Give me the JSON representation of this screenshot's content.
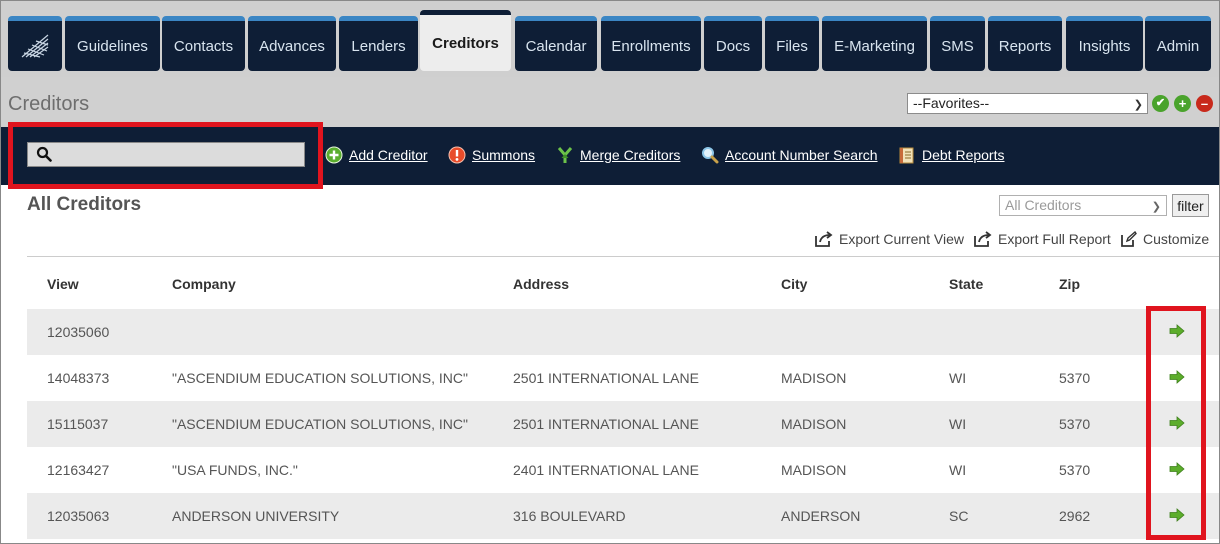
{
  "nav": {
    "tabs": [
      {
        "label": "Guidelines",
        "active": false
      },
      {
        "label": "Contacts",
        "active": false
      },
      {
        "label": "Advances",
        "active": false
      },
      {
        "label": "Lenders",
        "active": false
      },
      {
        "label": "Creditors",
        "active": true
      },
      {
        "label": "Calendar",
        "active": false
      },
      {
        "label": "Enrollments",
        "active": false
      },
      {
        "label": "Docs",
        "active": false
      },
      {
        "label": "Files",
        "active": false
      },
      {
        "label": "E-Marketing",
        "active": false
      },
      {
        "label": "SMS",
        "active": false
      },
      {
        "label": "Reports",
        "active": false
      },
      {
        "label": "Insights",
        "active": false
      },
      {
        "label": "Admin",
        "active": false
      }
    ]
  },
  "header": {
    "title": "Creditors",
    "favorites_value": "--Favorites--"
  },
  "toolbar": {
    "search_value": "",
    "links": {
      "add_creditor": "Add Creditor",
      "summons": "Summons",
      "merge_creditors": "Merge Creditors",
      "account_number_search": "Account Number Search",
      "debt_reports": "Debt Reports"
    }
  },
  "main": {
    "section_title": "All Creditors",
    "filter_value": "All Creditors",
    "filter_button": "filter",
    "actions": {
      "export_current": "Export Current View",
      "export_full": "Export Full Report",
      "customize": "Customize"
    },
    "table": {
      "columns": {
        "view": "View",
        "company": "Company",
        "address": "Address",
        "city": "City",
        "state": "State",
        "zip": "Zip"
      },
      "rows": [
        {
          "view": "12035060",
          "company": "",
          "address": "",
          "city": "",
          "state": "",
          "zip": ""
        },
        {
          "view": "14048373",
          "company": "\"ASCENDIUM EDUCATION SOLUTIONS, INC\"",
          "address": "2501 INTERNATIONAL LANE",
          "city": "MADISON",
          "state": "WI",
          "zip": "5370"
        },
        {
          "view": "15115037",
          "company": "\"ASCENDIUM EDUCATION SOLUTIONS, INC\"",
          "address": "2501 INTERNATIONAL LANE",
          "city": "MADISON",
          "state": "WI",
          "zip": "5370"
        },
        {
          "view": "12163427",
          "company": "\"USA FUNDS, INC.\"",
          "address": "2401 INTERNATIONAL LANE",
          "city": "MADISON",
          "state": "WI",
          "zip": "5370"
        },
        {
          "view": "12035063",
          "company": "ANDERSON UNIVERSITY",
          "address": "316 BOULEVARD",
          "city": "ANDERSON",
          "state": "SC",
          "zip": "2962"
        }
      ]
    }
  },
  "colors": {
    "nav_bg": "#0e1e36",
    "nav_accent": "#3b86c4",
    "highlight": "#e0141e",
    "go_green": "#5cad2b"
  }
}
